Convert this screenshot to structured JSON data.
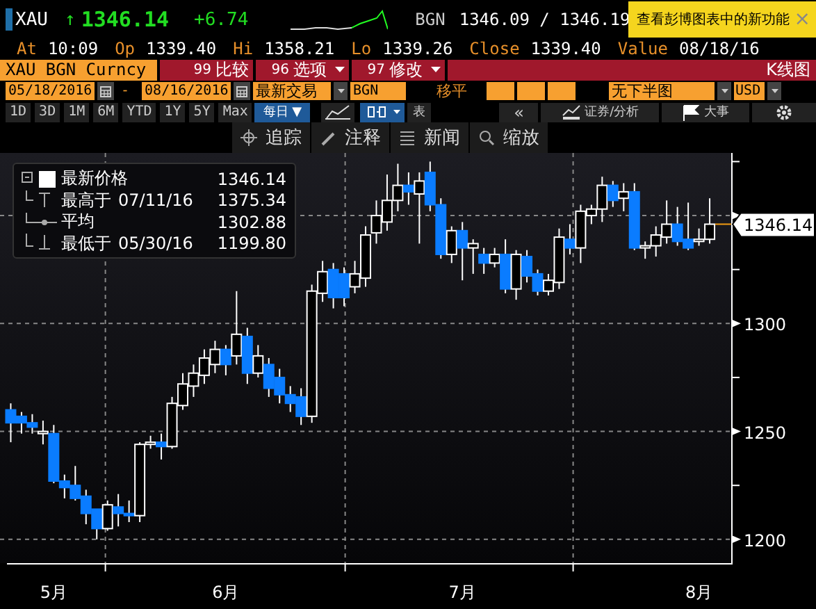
{
  "quote": {
    "ticker": "XAU",
    "arrow": "↑",
    "last": "1346.14",
    "change": "+6.74",
    "source": "BGN",
    "bid_ask": "1346.09 / 1346.19"
  },
  "tooltip": {
    "text": "查看彭博图表中的新功能",
    "close": "×"
  },
  "stats": [
    {
      "label": "At",
      "value": "10:09"
    },
    {
      "label": "Op",
      "value": "1339.40"
    },
    {
      "label": "Hi",
      "value": "1358.21"
    },
    {
      "label": "Lo",
      "value": "1339.26"
    },
    {
      "label": "Close",
      "value": "1339.40"
    },
    {
      "label": "Value",
      "value": "08/18/16"
    }
  ],
  "security_field": "XAU BGN Curncy",
  "menu_buttons": [
    {
      "code": "99",
      "label": "比较",
      "dropdown": false
    },
    {
      "code": "96",
      "label": "选项",
      "dropdown": true
    },
    {
      "code": "97",
      "label": "修改",
      "dropdown": true
    }
  ],
  "chart_type_title": "K线图",
  "start_date": "05/18/2016",
  "date_separator": "-",
  "end_date": "08/16/2016",
  "price_type": "最新交易",
  "price_source": "BGN",
  "moving_avg_label": "移平",
  "lower_chart": "无下半图",
  "currency": "USD",
  "periods": [
    {
      "label": "1D",
      "selected": false
    },
    {
      "label": "3D",
      "selected": false
    },
    {
      "label": "1M",
      "selected": false
    },
    {
      "label": "6M",
      "selected": false
    },
    {
      "label": "YTD",
      "selected": false
    },
    {
      "label": "1Y",
      "selected": false
    },
    {
      "label": "5Y",
      "selected": false
    },
    {
      "label": "Max",
      "selected": false
    }
  ],
  "frequency": "每日 ▼",
  "table_button": "表",
  "back_button": "«",
  "analysis_button": "证券/分析",
  "events_button": "大事",
  "tools": [
    {
      "kind": "track",
      "label": "追踪"
    },
    {
      "kind": "annotate",
      "label": "注释"
    },
    {
      "kind": "news",
      "label": "新闻"
    },
    {
      "kind": "zoom",
      "label": "缩放"
    }
  ],
  "legend": [
    {
      "kind": "last",
      "label": "最新价格",
      "value": "1346.14"
    },
    {
      "kind": "high",
      "label": "最高于",
      "date": "07/11/16",
      "value": "1375.34"
    },
    {
      "kind": "avg",
      "label": "平均",
      "value": "1302.88"
    },
    {
      "kind": "low",
      "label": "最低于",
      "date": "05/30/16",
      "value": "1199.80"
    }
  ],
  "price_tag": "1346.14",
  "chart_data": {
    "type": "candlestick",
    "grid": true,
    "ylim": [
      1189,
      1379
    ],
    "yticks": [
      1200,
      1250,
      1300
    ],
    "categories": [
      null,
      null,
      null,
      null,
      "5月",
      null,
      null,
      null,
      null,
      null,
      null,
      null,
      null,
      null,
      null,
      null,
      null,
      null,
      null,
      null,
      "6月",
      null,
      null,
      null,
      null,
      null,
      null,
      null,
      null,
      null,
      null,
      null,
      null,
      null,
      null,
      null,
      null,
      null,
      null,
      null,
      null,
      null,
      "7月",
      null,
      null,
      null,
      null,
      null,
      null,
      null,
      null,
      null,
      null,
      null,
      null,
      null,
      null,
      null,
      null,
      null,
      null,
      null,
      null,
      null,
      "8月",
      null
    ],
    "ohlc": [
      [
        1260,
        1263,
        1245,
        1254
      ],
      [
        1257,
        1259,
        1249,
        1254
      ],
      [
        1254,
        1258,
        1249,
        1252
      ],
      [
        1249,
        1255,
        1244,
        1250
      ],
      [
        1249,
        1253,
        1226,
        1227
      ],
      [
        1227,
        1230,
        1219,
        1224
      ],
      [
        1225,
        1234,
        1218,
        1219
      ],
      [
        1220,
        1223,
        1207,
        1212
      ],
      [
        1214,
        1214,
        1200,
        1205
      ],
      [
        1205,
        1218,
        1204,
        1216
      ],
      [
        1215,
        1221,
        1206,
        1212
      ],
      [
        1212,
        1218,
        1208,
        1211
      ],
      [
        1211,
        1245,
        1208,
        1244
      ],
      [
        1244,
        1248,
        1242,
        1245
      ],
      [
        1245,
        1249,
        1237,
        1243
      ],
      [
        1243,
        1266,
        1242,
        1263
      ],
      [
        1262,
        1277,
        1260,
        1272
      ],
      [
        1271,
        1281,
        1266,
        1277
      ],
      [
        1276,
        1288,
        1272,
        1284
      ],
      [
        1281,
        1292,
        1277,
        1288
      ],
      [
        1288,
        1290,
        1276,
        1281
      ],
      [
        1285,
        1315,
        1281,
        1295
      ],
      [
        1294,
        1298,
        1272,
        1277
      ],
      [
        1277,
        1290,
        1275,
        1285
      ],
      [
        1281,
        1284,
        1266,
        1270
      ],
      [
        1275,
        1279,
        1263,
        1267
      ],
      [
        1267,
        1271,
        1259,
        1263
      ],
      [
        1266,
        1270,
        1253,
        1257
      ],
      [
        1257,
        1318,
        1254,
        1315
      ],
      [
        1314,
        1329,
        1310,
        1324
      ],
      [
        1325,
        1328,
        1307,
        1312
      ],
      [
        1323,
        1326,
        1308,
        1312
      ],
      [
        1317,
        1329,
        1314,
        1323
      ],
      [
        1321,
        1345,
        1317,
        1341
      ],
      [
        1342,
        1357,
        1337,
        1350
      ],
      [
        1347,
        1369,
        1343,
        1357
      ],
      [
        1357,
        1374,
        1352,
        1364
      ],
      [
        1364,
        1370,
        1355,
        1361
      ],
      [
        1360,
        1370,
        1337,
        1366
      ],
      [
        1370,
        1375,
        1352,
        1355
      ],
      [
        1355,
        1358,
        1330,
        1332
      ],
      [
        1332,
        1345,
        1328,
        1343
      ],
      [
        1343,
        1347,
        1320,
        1335
      ],
      [
        1335,
        1339,
        1323,
        1337
      ],
      [
        1332,
        1335,
        1323,
        1328
      ],
      [
        1328,
        1335,
        1326,
        1332
      ],
      [
        1332,
        1339,
        1314,
        1316
      ],
      [
        1316,
        1334,
        1311,
        1332
      ],
      [
        1331,
        1334,
        1319,
        1322
      ],
      [
        1323,
        1325,
        1313,
        1315
      ],
      [
        1315,
        1323,
        1313,
        1320
      ],
      [
        1319,
        1344,
        1316,
        1340
      ],
      [
        1339,
        1346,
        1332,
        1335
      ],
      [
        1335,
        1355,
        1328,
        1352
      ],
      [
        1350,
        1355,
        1346,
        1353
      ],
      [
        1353,
        1368,
        1347,
        1364
      ],
      [
        1364,
        1366,
        1354,
        1357
      ],
      [
        1358,
        1365,
        1352,
        1361
      ],
      [
        1361,
        1365,
        1334,
        1335
      ],
      [
        1335,
        1338,
        1330,
        1336
      ],
      [
        1336,
        1345,
        1331,
        1341
      ],
      [
        1340,
        1357,
        1337,
        1346
      ],
      [
        1346,
        1354,
        1336,
        1338
      ],
      [
        1339,
        1356,
        1334,
        1335
      ],
      [
        1338,
        1344,
        1336,
        1339
      ],
      [
        1339,
        1358,
        1337,
        1346
      ]
    ]
  }
}
